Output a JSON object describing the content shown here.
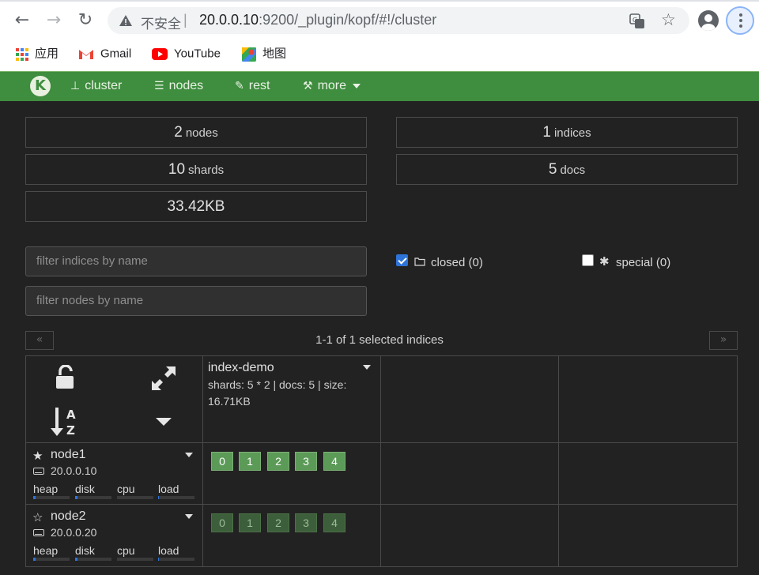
{
  "browser": {
    "insecure_label": "不安全",
    "url_host": "20.0.0.10",
    "url_rest": ":9200/_plugin/kopf/#!/cluster",
    "bookmarks": [
      {
        "label": "应用",
        "icon": "apps-grid-icon"
      },
      {
        "label": "Gmail",
        "icon": "gmail-icon"
      },
      {
        "label": "YouTube",
        "icon": "youtube-icon"
      },
      {
        "label": "地图",
        "icon": "maps-icon"
      }
    ]
  },
  "navbar": {
    "logo": "K",
    "items": [
      {
        "label": "cluster",
        "icon": "sitemap-icon"
      },
      {
        "label": "nodes",
        "icon": "server-icon"
      },
      {
        "label": "rest",
        "icon": "edit-icon"
      },
      {
        "label": "more",
        "icon": "magic-wand-icon"
      }
    ]
  },
  "stats": {
    "nodes": {
      "value": "2",
      "label": "nodes"
    },
    "indices": {
      "value": "1",
      "label": "indices"
    },
    "shards": {
      "value": "10",
      "label": "shards"
    },
    "docs": {
      "value": "5",
      "label": "docs"
    },
    "size": {
      "value": "33.42KB"
    }
  },
  "filters": {
    "indices_placeholder": "filter indices by name",
    "nodes_placeholder": "filter nodes by name",
    "closed_label": "closed (0)",
    "closed_checked": true,
    "special_label": "special (0)",
    "special_checked": false
  },
  "pager": {
    "prev": "«",
    "next": "»",
    "info": "1-1 of 1 selected indices"
  },
  "index": {
    "name": "index-demo",
    "info": "shards: 5 * 2 | docs: 5 | size: 16.71KB"
  },
  "nodes": [
    {
      "name": "node1",
      "ip": "20.0.0.10",
      "master": true,
      "metrics": [
        {
          "label": "heap",
          "value": 0.06
        },
        {
          "label": "disk",
          "value": 0.06
        },
        {
          "label": "cpu",
          "value": 0.0
        },
        {
          "label": "load",
          "value": 0.02
        }
      ],
      "shards": [
        "0",
        "1",
        "2",
        "3",
        "4"
      ],
      "shard_type": "primary"
    },
    {
      "name": "node2",
      "ip": "20.0.0.20",
      "master": false,
      "metrics": [
        {
          "label": "heap",
          "value": 0.06
        },
        {
          "label": "disk",
          "value": 0.06
        },
        {
          "label": "cpu",
          "value": 0.0
        },
        {
          "label": "load",
          "value": 0.02
        }
      ],
      "shards": [
        "0",
        "1",
        "2",
        "3",
        "4"
      ],
      "shard_type": "replica"
    }
  ],
  "colors": {
    "navbar": "#3f8d3f",
    "primary_shard": "#5b9a57",
    "replica_shard": "#3d5e3a",
    "accent_blue": "#2e74d8"
  }
}
